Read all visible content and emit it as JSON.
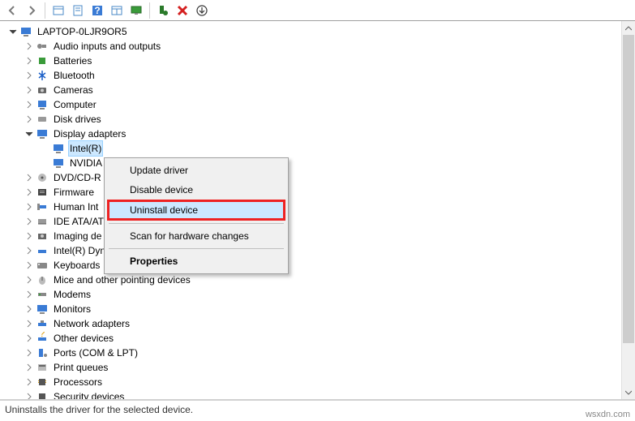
{
  "toolbar": {
    "icons": [
      "back",
      "forward",
      "",
      "view",
      "properties",
      "help",
      "refresh",
      "monitor",
      "",
      "plug",
      "cancel",
      "download"
    ]
  },
  "root": "LAPTOP-0LJR9OR5",
  "status": "Uninstalls the driver for the selected device.",
  "watermark": "wsxdn.com",
  "categories": [
    {
      "label": "Audio inputs and outputs",
      "exp": "right"
    },
    {
      "label": "Batteries",
      "exp": "right"
    },
    {
      "label": "Bluetooth",
      "exp": "right"
    },
    {
      "label": "Cameras",
      "exp": "right"
    },
    {
      "label": "Computer",
      "exp": "right"
    },
    {
      "label": "Disk drives",
      "exp": "right"
    },
    {
      "label": "Display adapters",
      "exp": "down",
      "children": [
        {
          "label": "Intel(R)",
          "sel": true
        },
        {
          "label": "NVIDIA"
        }
      ]
    },
    {
      "label": "DVD/CD-R",
      "exp": "right"
    },
    {
      "label": "Firmware",
      "exp": "right"
    },
    {
      "label": "Human Int",
      "exp": "right"
    },
    {
      "label": "IDE ATA/AT",
      "exp": "right"
    },
    {
      "label": "Imaging de",
      "exp": "right"
    },
    {
      "label": "Intel(R) Dynamic Platform and Thermal Framework",
      "exp": "right"
    },
    {
      "label": "Keyboards",
      "exp": "right"
    },
    {
      "label": "Mice and other pointing devices",
      "exp": "right"
    },
    {
      "label": "Modems",
      "exp": "right"
    },
    {
      "label": "Monitors",
      "exp": "right"
    },
    {
      "label": "Network adapters",
      "exp": "right"
    },
    {
      "label": "Other devices",
      "exp": "right"
    },
    {
      "label": "Ports (COM & LPT)",
      "exp": "right"
    },
    {
      "label": "Print queues",
      "exp": "right"
    },
    {
      "label": "Processors",
      "exp": "right"
    },
    {
      "label": "Security devices",
      "exp": "right"
    }
  ],
  "ctx": {
    "update": "Update driver",
    "disable": "Disable device",
    "uninstall": "Uninstall device",
    "scan": "Scan for hardware changes",
    "props": "Properties"
  }
}
